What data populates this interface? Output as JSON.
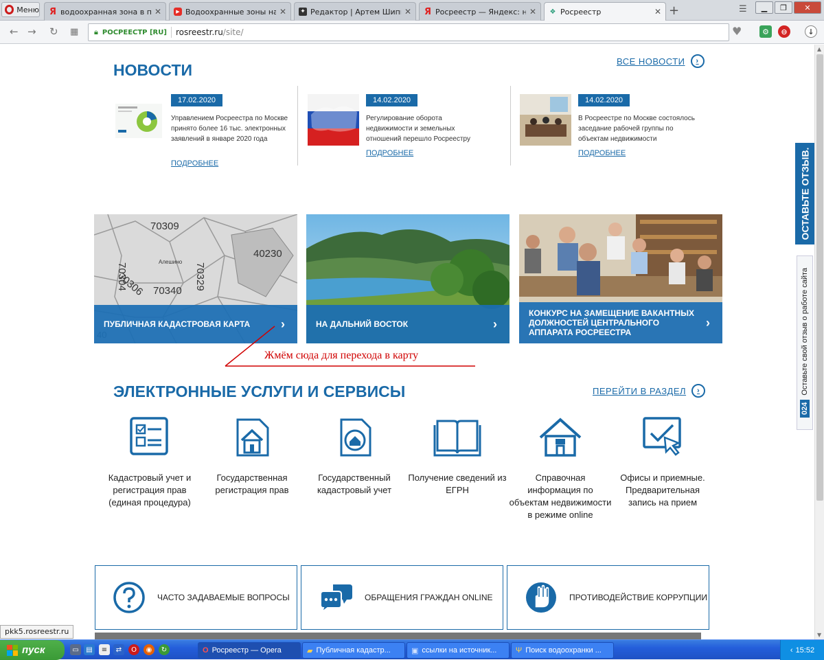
{
  "browser": {
    "menu_label": "Меню",
    "tabs": [
      {
        "title": "водоохранная зона в публ",
        "icon": "yandex-icon"
      },
      {
        "title": "Водоохранные зоны на кар",
        "icon": "youtube-icon"
      },
      {
        "title": "Редактор | Артем Шипилов",
        "icon": "editor-icon"
      },
      {
        "title": "Росреестр — Яндекс: нашл",
        "icon": "yandex-icon"
      },
      {
        "title": "Росреестр",
        "icon": "rosreestr-icon"
      }
    ],
    "secure_label": "РОСРЕЕСТР [RU]",
    "url_host": "rosreestr.ru",
    "url_path": "/site/"
  },
  "news": {
    "title": "НОВОСТИ",
    "all_link": "ВСЕ НОВОСТИ",
    "items": [
      {
        "date": "17.02.2020",
        "text": "Управлением Росреестра по Москве принято более 16 тыс. электронных заявлений в январе 2020 года",
        "more": "ПОДРОБНЕЕ"
      },
      {
        "date": "14.02.2020",
        "text": "Регулирование оборота недвижимости и земельных отношений перешло Росреестру",
        "more": "ПОДРОБНЕЕ"
      },
      {
        "date": "14.02.2020",
        "text": "В Росреестре по Москве состоялось заседание рабочей группы по объектам недвижимости",
        "more": "ПОДРОБНЕЕ"
      }
    ]
  },
  "banners": [
    {
      "caption": "ПУБЛИЧНАЯ КАДАСТРОВАЯ КАРТА",
      "map_labels": [
        "70309",
        "70304",
        "70329",
        "40230",
        "70306",
        "70340",
        "Алешино",
        "40"
      ]
    },
    {
      "caption": "НА ДАЛЬНИЙ ВОСТОК"
    },
    {
      "caption": "КОНКУРС НА ЗАМЕЩЕНИЕ ВАКАНТНЫХ ДОЛЖНОСТЕЙ ЦЕНТРАЛЬНОГО АППАРАТА РОСРЕЕСТРА"
    }
  ],
  "annotation": "Жмём сюда для перехода в карту",
  "services": {
    "title": "ЭЛЕКТРОННЫЕ УСЛУГИ И СЕРВИСЫ",
    "section_link": "ПЕРЕЙТИ В РАЗДЕЛ",
    "items": [
      {
        "label": "Кадастровый учет и регистрация прав (единая процедура)",
        "icon": "form-icon"
      },
      {
        "label": "Государственная регистрация прав",
        "icon": "house-document-icon"
      },
      {
        "label": "Государственный кадастровый учет",
        "icon": "house-circle-document-icon"
      },
      {
        "label": "Получение сведений из ЕГРН",
        "icon": "book-icon"
      },
      {
        "label": "Справочная информация по объектам недвижимости в режиме online",
        "icon": "house-icon"
      },
      {
        "label": "Офисы и приемные. Предварительная запись на прием",
        "icon": "checkbox-cursor-icon"
      }
    ]
  },
  "bottom_cards": [
    {
      "label": "ЧАСТО ЗАДАВАЕМЫЕ ВОПРОСЫ",
      "icon": "question-icon"
    },
    {
      "label": "ОБРАЩЕНИЯ ГРАЖДАН ONLINE",
      "icon": "chat-bubbles-icon"
    },
    {
      "label": "ПРОТИВОДЕЙСТВИЕ КОРРУПЦИИ",
      "icon": "hand-stop-icon"
    }
  ],
  "feedback": {
    "tab_label": "ОСТАВЬТЕ ОТЗЫВ.",
    "widget_label": "Оставьте свой отзыв о работе сайта",
    "widget_badge": "024"
  },
  "status_url": "pkk5.rosreestr.ru",
  "taskbar": {
    "start_label": "пуск",
    "windows": [
      {
        "label": "Росреестр — Opera",
        "active": true
      },
      {
        "label": "Публичная кадастр...",
        "active": false
      },
      {
        "label": "ссылки на источник...",
        "active": false
      },
      {
        "label": "Поиск водоохранки ...",
        "active": false
      }
    ],
    "clock": "15:52"
  },
  "colors": {
    "brand_blue": "#1a6aa8",
    "annotation_red": "#d00000"
  }
}
